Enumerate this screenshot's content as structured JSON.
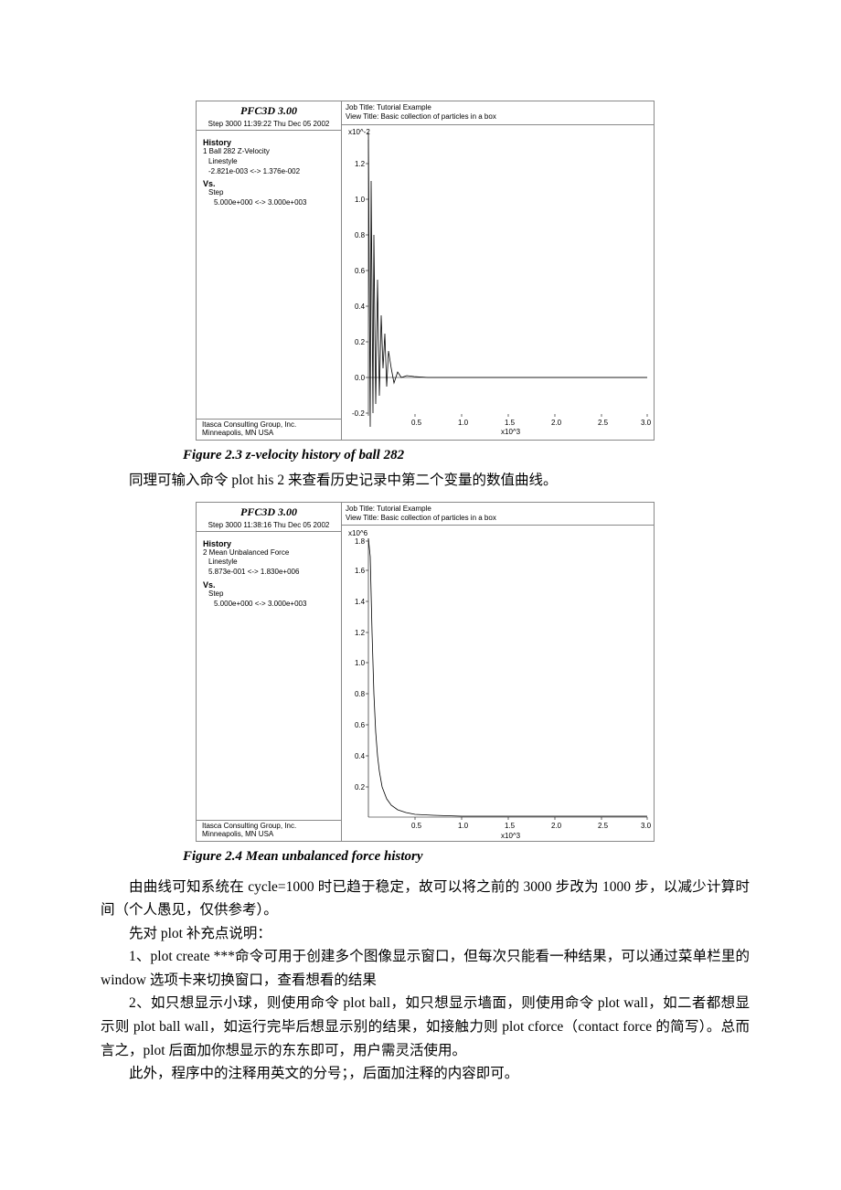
{
  "fig1": {
    "software": "PFC3D 3.00",
    "step": "Step 3000  11:39:22 Thu Dec 05 2002",
    "hist_head": "History",
    "hist1": "1 Ball 282 Z-Velocity",
    "hist2": "Linestyle",
    "hist3": "-2.821e-003 <-> 1.376e-002",
    "vs": "Vs.",
    "vs1": "Step",
    "vs2": "5.000e+000 <-> 3.000e+003",
    "foot1": "Itasca Consulting Group, Inc.",
    "foot2": "Minneapolis, MN  USA",
    "job": "Job Title: Tutorial Example",
    "view": "View Title: Basic collection of particles in a box",
    "ymul": "x10^-2",
    "xmul": "x10^3",
    "caption": "Figure 2.3    z-velocity history of ball 282"
  },
  "text_mid": "同理可输入命令 plot his 2 来查看历史记录中第二个变量的数值曲线。",
  "fig2": {
    "software": "PFC3D 3.00",
    "step": "Step 3000  11:38:16 Thu Dec 05 2002",
    "hist_head": "History",
    "hist1": "2 Mean Unbalanced Force",
    "hist2": "Linestyle",
    "hist3": "5.873e-001 <-> 1.830e+006",
    "vs": "Vs.",
    "vs1": "Step",
    "vs2": "5.000e+000 <-> 3.000e+003",
    "foot1": "Itasca Consulting Group, Inc.",
    "foot2": "Minneapolis, MN  USA",
    "job": "Job Title: Tutorial Example",
    "view": "View Title: Basic collection of particles in a box",
    "ymul": "x10^6",
    "xmul": "x10^3",
    "caption": "Figure 2.4    Mean unbalanced force history"
  },
  "para1": "由曲线可知系统在 cycle=1000 时已趋于稳定，故可以将之前的 3000 步改为 1000 步，以减少计算时间（个人愚见，仅供参考）。",
  "para2": "先对 plot 补充点说明：",
  "para3": "1、plot create ***命令可用于创建多个图像显示窗口，但每次只能看一种结果，可以通过菜单栏里的 window 选项卡来切换窗口，查看想看的结果",
  "para4": "2、如只想显示小球，则使用命令 plot ball，如只想显示墙面，则使用命令 plot wall，如二者都想显示则 plot ball wall，如运行完毕后想显示别的结果，如接触力则 plot cforce（contact force 的简写）。总而言之，plot 后面加你想显示的东东即可，用户需灵活使用。",
  "para5": "此外，程序中的注释用英文的分号；，后面加注释的内容即可。",
  "chart_data": [
    {
      "type": "line",
      "title": "z-velocity history of ball 282",
      "xlabel": "Step (x10^3)",
      "ylabel": "Z-Velocity (x10^-2)",
      "xlim": [
        0,
        3.0
      ],
      "ylim": [
        -0.2,
        1.4
      ],
      "xticks": [
        0.5,
        1.0,
        1.5,
        2.0,
        2.5,
        3.0
      ],
      "yticks": [
        -0.2,
        0.0,
        0.2,
        0.4,
        0.6,
        0.8,
        1.0,
        1.2
      ],
      "series": [
        {
          "name": "Ball 282 Z-Velocity",
          "x": [
            0.005,
            0.02,
            0.03,
            0.04,
            0.05,
            0.06,
            0.08,
            0.1,
            0.12,
            0.14,
            0.16,
            0.18,
            0.2,
            0.25,
            0.3,
            0.35,
            0.4,
            0.5,
            0.7,
            1.0,
            1.5,
            2.0,
            2.5,
            3.0
          ],
          "y": [
            1.376,
            -0.28,
            1.1,
            -0.2,
            0.8,
            -0.15,
            0.55,
            -0.1,
            0.35,
            0.25,
            -0.05,
            0.15,
            0.1,
            0.05,
            -0.03,
            0.04,
            0.02,
            0.01,
            0.005,
            0.002,
            0.0,
            0.0,
            0.0,
            0.0
          ]
        }
      ]
    },
    {
      "type": "line",
      "title": "Mean unbalanced force history",
      "xlabel": "Step (x10^3)",
      "ylabel": "Mean Unbalanced Force (x10^6)",
      "xlim": [
        0,
        3.0
      ],
      "ylim": [
        0,
        1.8
      ],
      "xticks": [
        0.5,
        1.0,
        1.5,
        2.0,
        2.5,
        3.0
      ],
      "yticks": [
        0.2,
        0.4,
        0.6,
        0.8,
        1.0,
        1.2,
        1.4,
        1.6,
        1.8
      ],
      "series": [
        {
          "name": "Mean Unbalanced Force",
          "x": [
            0.005,
            0.02,
            0.04,
            0.06,
            0.08,
            0.1,
            0.12,
            0.15,
            0.2,
            0.25,
            0.3,
            0.4,
            0.5,
            0.7,
            1.0,
            1.5,
            2.0,
            2.5,
            3.0
          ],
          "y": [
            1.83,
            1.7,
            1.2,
            0.8,
            0.55,
            0.4,
            0.3,
            0.2,
            0.12,
            0.08,
            0.05,
            0.03,
            0.02,
            0.01,
            0.005,
            0.002,
            0.001,
            0.0006,
            0.0006
          ]
        }
      ]
    }
  ]
}
